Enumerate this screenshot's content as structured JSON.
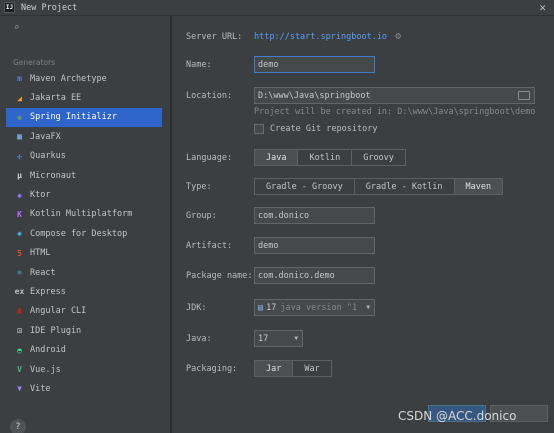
{
  "window": {
    "title": "New Project"
  },
  "sidebar": {
    "search_placeholder": "",
    "section_label": "Generators",
    "items": [
      {
        "label": "Maven Archetype",
        "icon": "maven-icon",
        "glyph": "m",
        "color": "#5c7fd6"
      },
      {
        "label": "Jakarta EE",
        "icon": "jakarta-icon",
        "glyph": "◢",
        "color": "#f0a030"
      },
      {
        "label": "Spring Initializr",
        "icon": "spring-icon",
        "glyph": "❀",
        "color": "#6db33f",
        "selected": true
      },
      {
        "label": "JavaFX",
        "icon": "javafx-icon",
        "glyph": "▦",
        "color": "#8ab4f8"
      },
      {
        "label": "Quarkus",
        "icon": "quarkus-icon",
        "glyph": "✣",
        "color": "#4695eb"
      },
      {
        "label": "Micronaut",
        "icon": "micronaut-icon",
        "glyph": "μ",
        "color": "#d0d0d0"
      },
      {
        "label": "Ktor",
        "icon": "ktor-icon",
        "glyph": "◆",
        "color": "#9b6bff"
      },
      {
        "label": "Kotlin Multiplatform",
        "icon": "kotlin-icon",
        "glyph": "K",
        "color": "#b36cff"
      },
      {
        "label": "Compose for Desktop",
        "icon": "compose-icon",
        "glyph": "◈",
        "color": "#4fc3f7"
      },
      {
        "label": "HTML",
        "icon": "html-icon",
        "glyph": "5",
        "color": "#e44d26"
      },
      {
        "label": "React",
        "icon": "react-icon",
        "glyph": "⚛",
        "color": "#61dafb"
      },
      {
        "label": "Express",
        "icon": "express-icon",
        "glyph": "ex",
        "color": "#bbbbbb"
      },
      {
        "label": "Angular CLI",
        "icon": "angular-icon",
        "glyph": "A",
        "color": "#dd1b16"
      },
      {
        "label": "IDE Plugin",
        "icon": "plugin-icon",
        "glyph": "⊡",
        "color": "#c0c0c0"
      },
      {
        "label": "Android",
        "icon": "android-icon",
        "glyph": "◓",
        "color": "#3ddc84"
      },
      {
        "label": "Vue.js",
        "icon": "vue-icon",
        "glyph": "V",
        "color": "#41b883"
      },
      {
        "label": "Vite",
        "icon": "vite-icon",
        "glyph": "▼",
        "color": "#a97bff"
      }
    ],
    "help": "?"
  },
  "form": {
    "server_url_label": "Server URL:",
    "server_url": "http://start.springboot.io",
    "name_label": "Name:",
    "name_value": "demo",
    "location_label": "Location:",
    "location_value": "D:\\www\\Java\\springboot",
    "location_hint": "Project will be created in: D:\\www\\Java\\springboot\\demo",
    "git_label": "Create Git repository",
    "language_label": "Language:",
    "languages": [
      "Java",
      "Kotlin",
      "Groovy"
    ],
    "type_label": "Type:",
    "types": [
      "Gradle - Groovy",
      "Gradle - Kotlin",
      "Maven"
    ],
    "group_label": "Group:",
    "group_value": "com.donico",
    "artifact_label": "Artifact:",
    "artifact_value": "demo",
    "package_label": "Package name:",
    "package_value": "com.donico.demo",
    "jdk_label": "JDK:",
    "jdk_value": "17",
    "jdk_detail": "java version \"1",
    "java_label": "Java:",
    "java_value": "17",
    "packaging_label": "Packaging:",
    "packagings": [
      "Jar",
      "War"
    ]
  },
  "watermark": "CSDN @ACC.donico",
  "colors": {
    "accent": "#2f65ca",
    "link": "#589df6",
    "focus": "#3d7fc9"
  }
}
